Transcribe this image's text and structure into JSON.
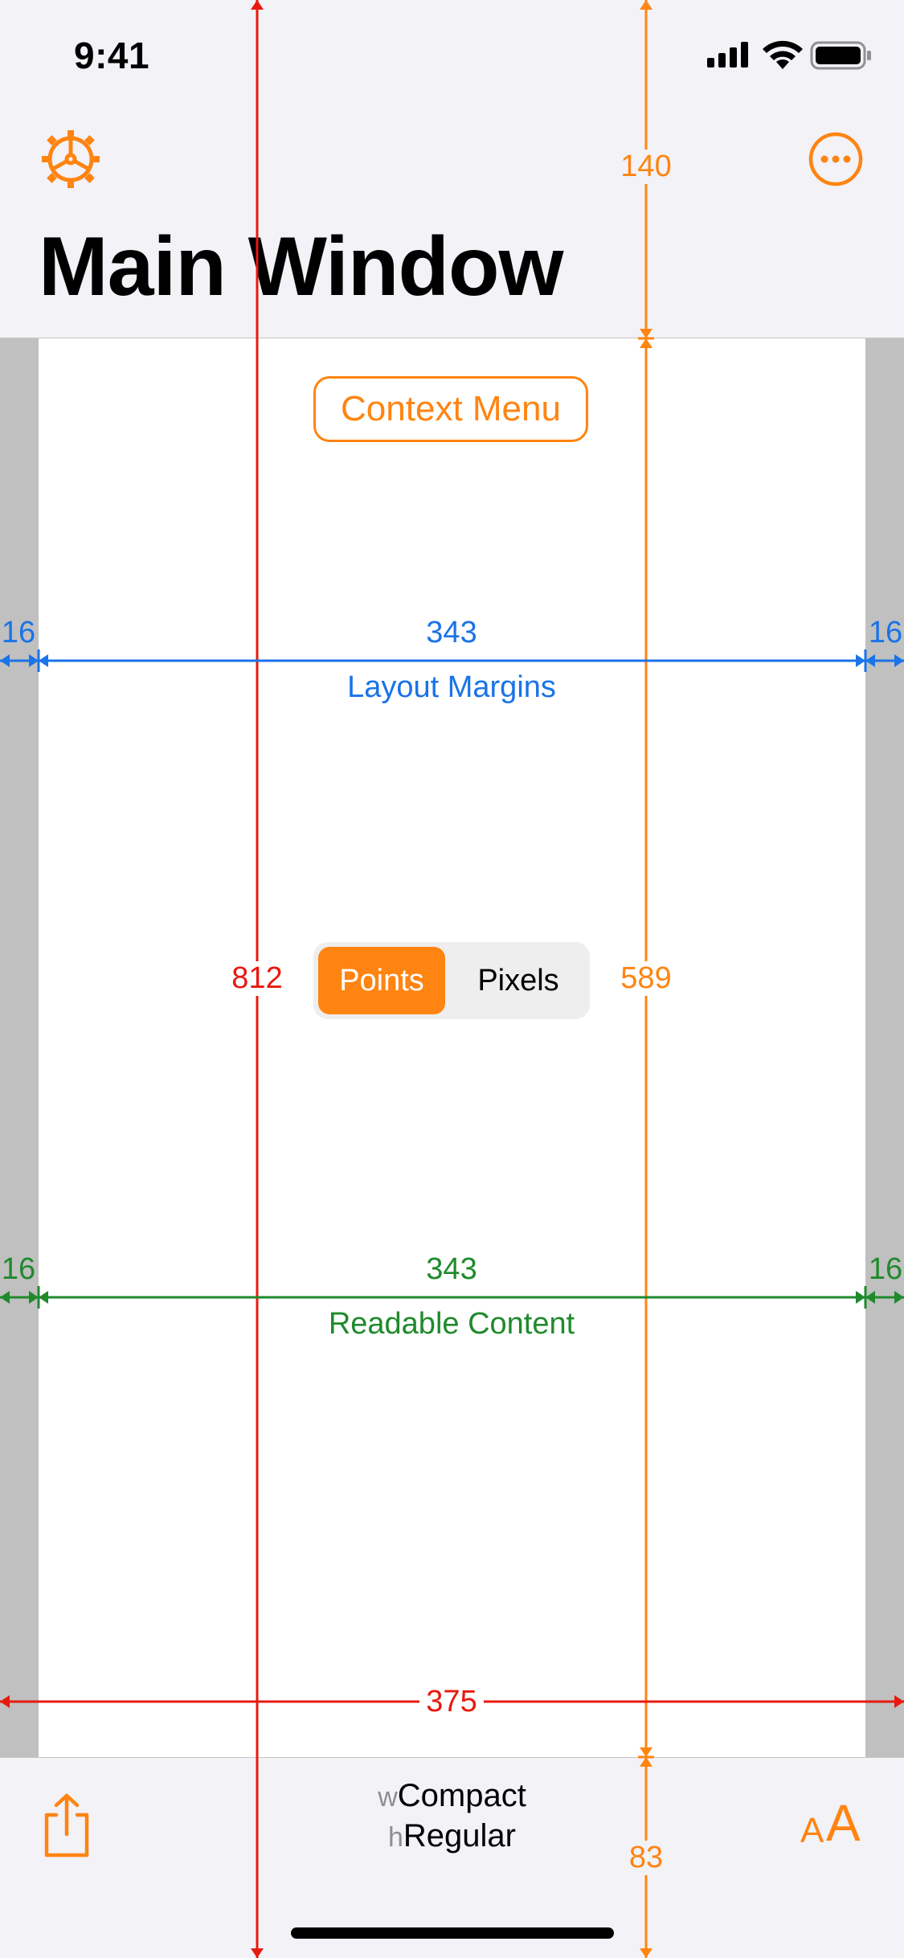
{
  "status_bar": {
    "time": "9:41"
  },
  "nav": {
    "title": "Main Window"
  },
  "context_button": {
    "label": "Context Menu"
  },
  "segmented": {
    "options": [
      "Points",
      "Pixels"
    ],
    "selected": "Points"
  },
  "measurements": {
    "nav_height": "140",
    "layout_margin_left": "16",
    "layout_width": "343",
    "layout_margin_right": "16",
    "layout_label": "Layout Margins",
    "window_height": "812",
    "content_height": "589",
    "readable_margin_left": "16",
    "readable_width": "343",
    "readable_margin_right": "16",
    "readable_label": "Readable Content",
    "window_width": "375",
    "toolbar_height": "83"
  },
  "toolbar": {
    "width_prefix": "w",
    "width_class": "Compact",
    "height_prefix": "h",
    "height_class": "Regular",
    "text_size_glyph": "AA"
  },
  "colors": {
    "accent": "#FF8411",
    "layout_margins": "#1A73E8",
    "readable_content": "#1F8A2C",
    "window_size": "#E8190F"
  },
  "icons": [
    "settings-icon",
    "more-icon",
    "share-icon",
    "text-size-icon",
    "cellular-signal-icon",
    "wifi-icon",
    "battery-icon"
  ]
}
